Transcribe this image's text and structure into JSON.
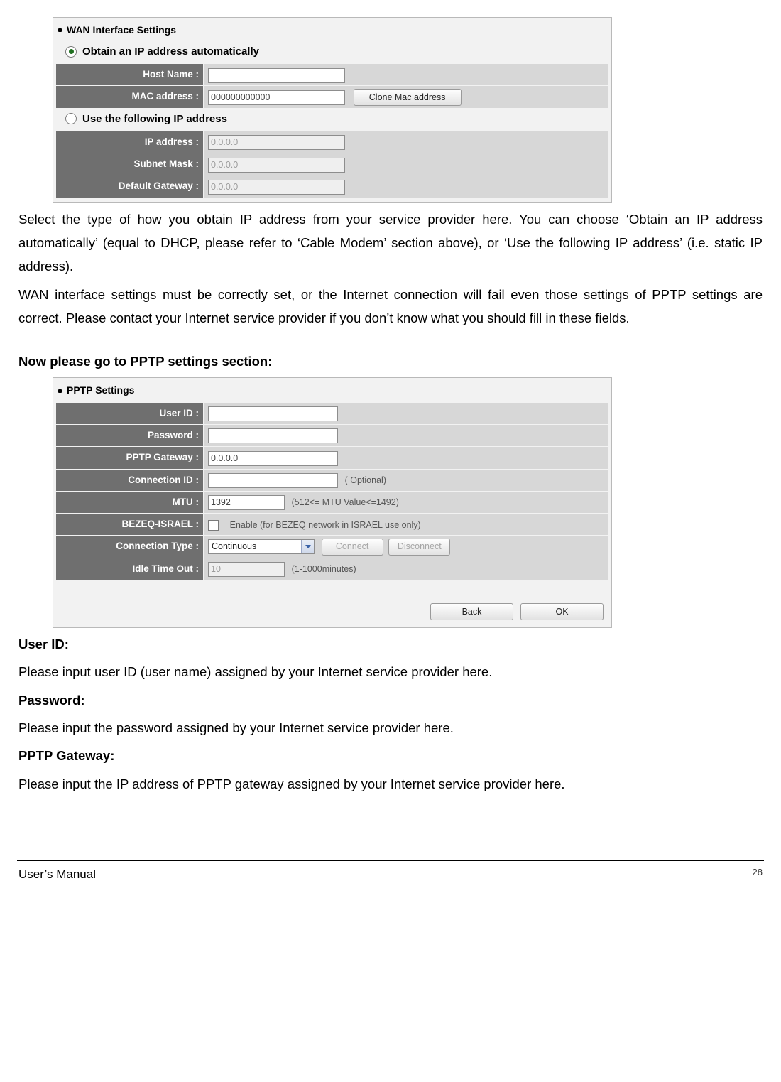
{
  "panel1": {
    "title": "WAN Interface Settings",
    "opt_auto": "Obtain an IP address automatically",
    "opt_static": "Use the following IP address",
    "rows": {
      "host_name": {
        "label": "Host Name :",
        "value": ""
      },
      "mac": {
        "label": "MAC address :",
        "value": "000000000000"
      },
      "ip": {
        "label": "IP address :",
        "value": "0.0.0.0"
      },
      "subnet": {
        "label": "Subnet Mask :",
        "value": "0.0.0.0"
      },
      "gateway": {
        "label": "Default Gateway :",
        "value": "0.0.0.0"
      }
    },
    "clone_btn": "Clone Mac address"
  },
  "para1": "Select the type of how you obtain IP address from your service provider here. You can choose ‘Obtain an IP address automatically’ (equal to DHCP, please refer to ‘Cable Modem’ section above), or ‘Use the following IP address’ (i.e. static IP address).",
  "para2": "WAN interface settings must be correctly set, or the Internet connection will fail even those settings of PPTP settings are correct. Please contact your Internet service provider if you don’t know what you should fill in these fields.",
  "heading_pptp": "Now please go to PPTP settings section:",
  "panel2": {
    "title": "PPTP Settings",
    "rows": {
      "user_id": {
        "label": "User ID :",
        "value": ""
      },
      "password": {
        "label": "Password :",
        "value": ""
      },
      "pptp_gw": {
        "label": "PPTP Gateway :",
        "value": "0.0.0.0"
      },
      "conn_id": {
        "label": "Connection ID :",
        "value": "",
        "hint": "( Optional)"
      },
      "mtu": {
        "label": "MTU :",
        "value": "1392",
        "hint": "(512<= MTU Value<=1492)"
      },
      "bezeq": {
        "label": "BEZEQ-ISRAEL :",
        "hint": "Enable (for BEZEQ network in ISRAEL use only)"
      },
      "conn_type": {
        "label": "Connection Type :",
        "value": "Continuous"
      },
      "idle": {
        "label": "Idle Time Out :",
        "value": "10",
        "hint": "(1-1000minutes)"
      }
    },
    "connect_btn": "Connect",
    "disconnect_btn": "Disconnect",
    "back_btn": "Back",
    "ok_btn": "OK"
  },
  "desc": {
    "user_id_h": "User ID:",
    "user_id_p": "Please input user ID (user name) assigned by your Internet service provider here.",
    "password_h": "Password:",
    "password_p": "Please input the password assigned by your Internet service provider here.",
    "pptp_gw_h": "PPTP Gateway:",
    "pptp_gw_p": "Please input the IP address of PPTP gateway assigned by your Internet service provider here."
  },
  "footer": {
    "left": "User’s Manual",
    "page": "28"
  }
}
